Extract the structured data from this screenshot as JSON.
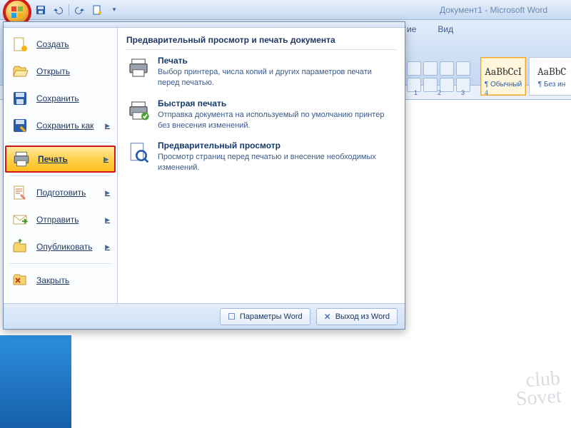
{
  "window": {
    "title": "Документ1 - Microsoft Word"
  },
  "qat": {
    "save": "save-icon",
    "undo": "undo-icon",
    "redo": "redo-icon",
    "new": "new-icon"
  },
  "ribbon": {
    "tab_partial": "ие",
    "tab_view": "Вид",
    "styles": {
      "normal_preview": "AaBbCcI",
      "normal_label": "¶ Обычный",
      "noindent_preview": "AaBbC",
      "noindent_label": "¶ Без ин"
    }
  },
  "ruler": {
    "marks": [
      "1",
      "2",
      "3",
      "4"
    ]
  },
  "office_menu": {
    "left": {
      "create": "Создать",
      "open": "Открыть",
      "save": "Сохранить",
      "save_as": "Сохранить как",
      "print": "Печать",
      "prepare": "Подготовить",
      "send": "Отправить",
      "publish": "Опубликовать",
      "close": "Закрыть"
    },
    "right": {
      "title": "Предварительный просмотр и печать документа",
      "items": [
        {
          "title": "Печать",
          "desc": "Выбор принтера, числа копий и других параметров печати перед печатью."
        },
        {
          "title": "Быстрая печать",
          "desc": "Отправка документа на используемый по умолчанию принтер без внесения изменений."
        },
        {
          "title": "Предварительный просмотр",
          "desc": "Просмотр страниц перед печатью и внесение необходимых изменений."
        }
      ]
    },
    "footer": {
      "options": "Параметры Word",
      "exit": "Выход из Word"
    }
  },
  "watermark": {
    "line1": "club",
    "line2": "Sovet"
  }
}
